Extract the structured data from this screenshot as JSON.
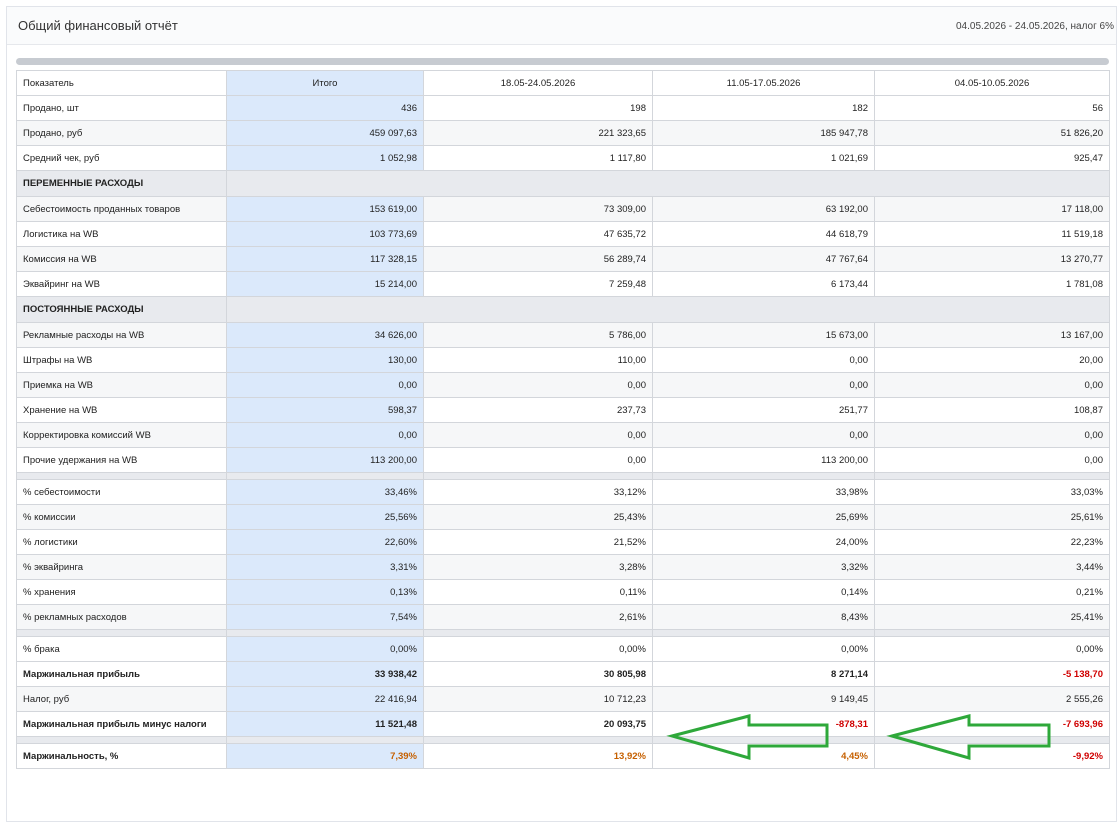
{
  "header": {
    "title": "Общий финансовый отчёт",
    "meta": "04.05.2026 - 24.05.2026, налог 6%"
  },
  "table": {
    "columns": [
      "Показатель",
      "Итого",
      "18.05-24.05.2026",
      "11.05-17.05.2026",
      "04.05-10.05.2026"
    ],
    "rows": [
      {
        "k": "sold_qty",
        "cells": [
          "Продано, шт",
          "436",
          "198",
          "182",
          "56"
        ]
      },
      {
        "k": "sold_rub",
        "cells": [
          "Продано, руб",
          "459 097,63",
          "221 323,65",
          "185 947,78",
          "51 826,20"
        ]
      },
      {
        "k": "avg_check",
        "cells": [
          "Средний чек, руб",
          "1 052,98",
          "1 117,80",
          "1 021,69",
          "925,47"
        ]
      },
      {
        "k": "sec_var",
        "cells": [
          "ПЕРЕМЕННЫЕ РАСХОДЫ"
        ]
      },
      {
        "k": "cogs",
        "cells": [
          "Себестоимость проданных товаров",
          "153 619,00",
          "73 309,00",
          "63 192,00",
          "17 118,00"
        ]
      },
      {
        "k": "logistics",
        "cells": [
          "Логистика на WB",
          "103 773,69",
          "47 635,72",
          "44 618,79",
          "11 519,18"
        ]
      },
      {
        "k": "commission",
        "cells": [
          "Комиссия на WB",
          "117 328,15",
          "56 289,74",
          "47 767,64",
          "13 270,77"
        ]
      },
      {
        "k": "acquiring",
        "cells": [
          "Эквайринг на WB",
          "15 214,00",
          "7 259,48",
          "6 173,44",
          "1 781,08"
        ]
      },
      {
        "k": "sec_fix",
        "cells": [
          "ПОСТОЯННЫЕ РАСХОДЫ"
        ]
      },
      {
        "k": "ads",
        "cells": [
          "Рекламные расходы на WB",
          "34 626,00",
          "5 786,00",
          "15 673,00",
          "13 167,00"
        ]
      },
      {
        "k": "fines",
        "cells": [
          "Штрафы на WB",
          "130,00",
          "110,00",
          "0,00",
          "20,00"
        ]
      },
      {
        "k": "acceptance",
        "cells": [
          "Приемка на WB",
          "0,00",
          "0,00",
          "0,00",
          "0,00"
        ]
      },
      {
        "k": "storage",
        "cells": [
          "Хранение на WB",
          "598,37",
          "237,73",
          "251,77",
          "108,87"
        ]
      },
      {
        "k": "corr",
        "cells": [
          "Корректировка комиссий WB",
          "0,00",
          "0,00",
          "0,00",
          "0,00"
        ]
      },
      {
        "k": "other",
        "cells": [
          "Прочие удержания на WB",
          "113 200,00",
          "0,00",
          "113 200,00",
          "0,00"
        ]
      },
      {
        "k": "pct_cogs",
        "cells": [
          "% себестоимости",
          "33,46%",
          "33,12%",
          "33,98%",
          "33,03%"
        ]
      },
      {
        "k": "pct_comm",
        "cells": [
          "% комиссии",
          "25,56%",
          "25,43%",
          "25,69%",
          "25,61%"
        ]
      },
      {
        "k": "pct_log",
        "cells": [
          "% логистики",
          "22,60%",
          "21,52%",
          "24,00%",
          "22,23%"
        ]
      },
      {
        "k": "pct_acq",
        "cells": [
          "% эквайринга",
          "3,31%",
          "3,28%",
          "3,32%",
          "3,44%"
        ]
      },
      {
        "k": "pct_stor",
        "cells": [
          "% хранения",
          "0,13%",
          "0,11%",
          "0,14%",
          "0,21%"
        ]
      },
      {
        "k": "pct_ads",
        "cells": [
          "% рекламных расходов",
          "7,54%",
          "2,61%",
          "8,43%",
          "25,41%"
        ]
      },
      {
        "k": "pct_defect",
        "cells": [
          "% брака",
          "0,00%",
          "0,00%",
          "0,00%",
          "0,00%"
        ]
      },
      {
        "k": "margin",
        "cells": [
          "Маржинальная прибыль",
          "33 938,42",
          "30 805,98",
          "8 271,14",
          "-5 138,70"
        ]
      },
      {
        "k": "tax",
        "cells": [
          "Налог, руб",
          "22 416,94",
          "10 712,23",
          "9 149,45",
          "2 555,26"
        ]
      },
      {
        "k": "margin_net",
        "cells": [
          "Маржинальная прибыль минус налоги",
          "11 521,48",
          "20 093,75",
          "-878,31",
          "-7 693,96"
        ]
      },
      {
        "k": "margin_pct",
        "cells": [
          "Маржинальность, %",
          "7,39%",
          "13,92%",
          "4,45%",
          "-9,92%"
        ]
      }
    ]
  },
  "annotation": {
    "arrow_color": "#2ea83a"
  }
}
